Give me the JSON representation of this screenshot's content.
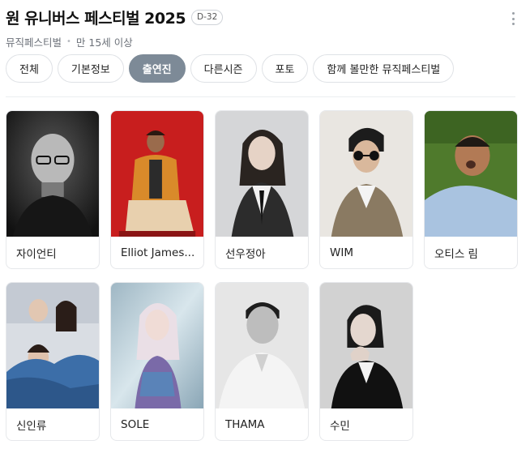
{
  "header": {
    "title": "원 유니버스 페스티벌 2025",
    "dday": "D-32",
    "category": "뮤직페스티벌",
    "age": "만 15세 이상"
  },
  "tabs": [
    {
      "label": "전체",
      "active": false
    },
    {
      "label": "기본정보",
      "active": false
    },
    {
      "label": "출연진",
      "active": true
    },
    {
      "label": "다른시즌",
      "active": false
    },
    {
      "label": "포토",
      "active": false
    },
    {
      "label": "함께 볼만한 뮤직페스티벌",
      "active": false
    }
  ],
  "performers": [
    {
      "name": "자이언티"
    },
    {
      "name": "Elliot James..."
    },
    {
      "name": "선우정아"
    },
    {
      "name": "WIM"
    },
    {
      "name": "오티스 림"
    },
    {
      "name": "신인류"
    },
    {
      "name": "SOLE"
    },
    {
      "name": "THAMA"
    },
    {
      "name": "수민"
    }
  ],
  "colors": {
    "active_tab": "#7d8a97",
    "border": "#dfe2e6"
  }
}
